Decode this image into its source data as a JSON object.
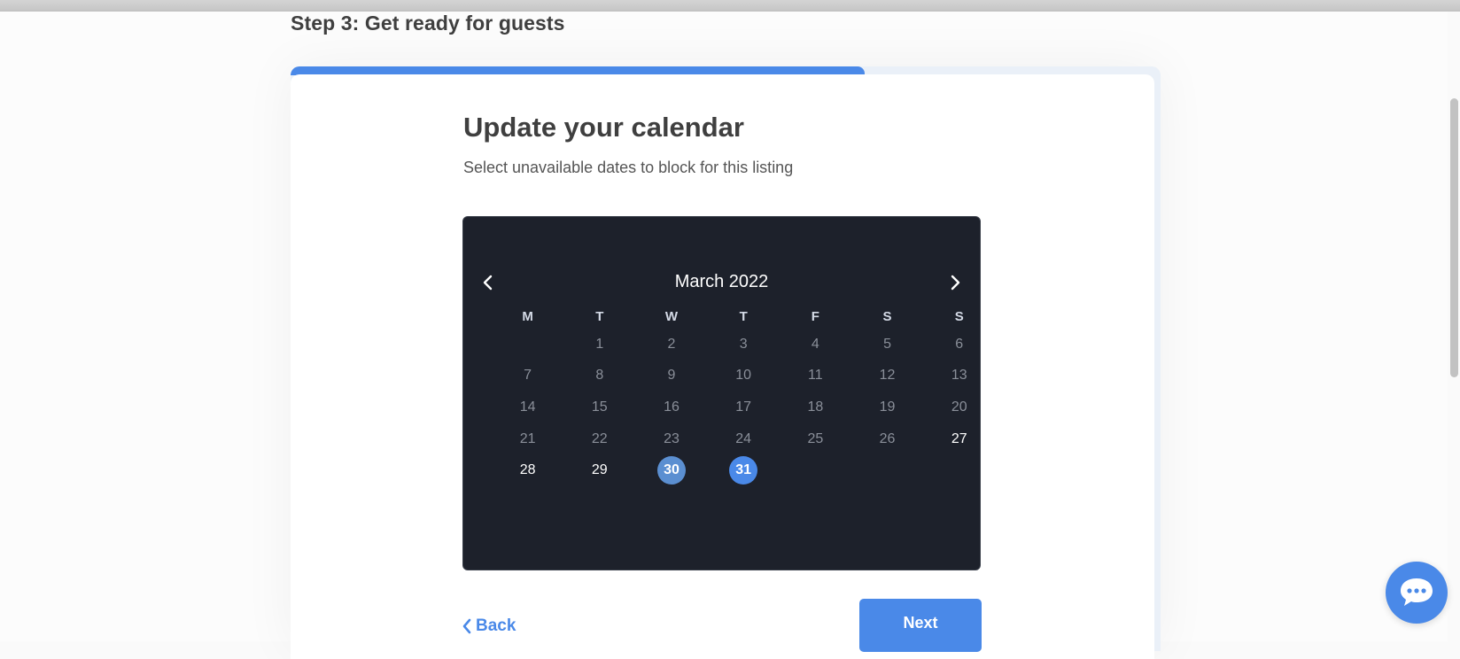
{
  "step": {
    "title": "Step 3: Get ready for guests"
  },
  "progress": {
    "fraction": 0.66
  },
  "card": {
    "title": "Update your calendar",
    "subtitle": "Select unavailable dates to block for this listing"
  },
  "calendar": {
    "month_label": "March 2022",
    "weekdays": [
      "M",
      "T",
      "W",
      "T",
      "F",
      "S",
      "S"
    ],
    "leading_blanks": 1,
    "days": [
      {
        "d": "1",
        "state": "past"
      },
      {
        "d": "2",
        "state": "past"
      },
      {
        "d": "3",
        "state": "past"
      },
      {
        "d": "4",
        "state": "past"
      },
      {
        "d": "5",
        "state": "past"
      },
      {
        "d": "6",
        "state": "past"
      },
      {
        "d": "7",
        "state": "past"
      },
      {
        "d": "8",
        "state": "past"
      },
      {
        "d": "9",
        "state": "past"
      },
      {
        "d": "10",
        "state": "past"
      },
      {
        "d": "11",
        "state": "past"
      },
      {
        "d": "12",
        "state": "past"
      },
      {
        "d": "13",
        "state": "past"
      },
      {
        "d": "14",
        "state": "past"
      },
      {
        "d": "15",
        "state": "past"
      },
      {
        "d": "16",
        "state": "past"
      },
      {
        "d": "17",
        "state": "past"
      },
      {
        "d": "18",
        "state": "past"
      },
      {
        "d": "19",
        "state": "past"
      },
      {
        "d": "20",
        "state": "past"
      },
      {
        "d": "21",
        "state": "past"
      },
      {
        "d": "22",
        "state": "past"
      },
      {
        "d": "23",
        "state": "past"
      },
      {
        "d": "24",
        "state": "past"
      },
      {
        "d": "25",
        "state": "past"
      },
      {
        "d": "26",
        "state": "past"
      },
      {
        "d": "27",
        "state": "active"
      },
      {
        "d": "28",
        "state": "active"
      },
      {
        "d": "29",
        "state": "active"
      },
      {
        "d": "30",
        "state": "selected-range"
      },
      {
        "d": "31",
        "state": "selected"
      }
    ]
  },
  "actions": {
    "back_label": "Back",
    "next_label": "Next"
  },
  "icons": {
    "prev": "chevron-left-icon",
    "next": "chevron-right-icon",
    "back": "chevron-left-icon",
    "chat": "chat-bubble-icon"
  },
  "colors": {
    "accent": "#4a89e8",
    "calendar_bg": "#1d212b"
  }
}
